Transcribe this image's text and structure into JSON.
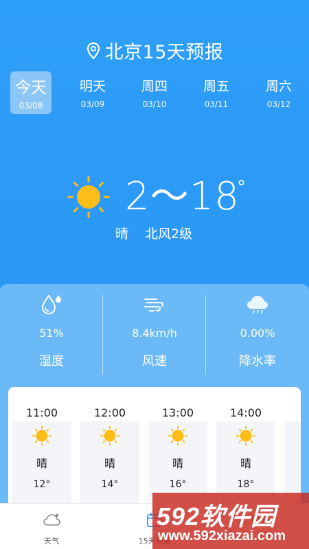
{
  "header": {
    "title": "北京15天预报",
    "location_icon": "location-pin-icon"
  },
  "days": [
    {
      "name": "今天",
      "date": "03/08",
      "active": true
    },
    {
      "name": "明天",
      "date": "03/09",
      "active": false
    },
    {
      "name": "周四",
      "date": "03/10",
      "active": false
    },
    {
      "name": "周五",
      "date": "03/11",
      "active": false
    },
    {
      "name": "周六",
      "date": "03/12",
      "active": false
    }
  ],
  "current": {
    "weather_icon": "sun-icon",
    "temp_range": "2～18",
    "degree_symbol": "°",
    "condition": "晴",
    "wind": "北风2级"
  },
  "stats": [
    {
      "icon": "humidity-icon",
      "value": "51%",
      "label": "湿度"
    },
    {
      "icon": "wind-speed-icon",
      "value": "8.4km/h",
      "label": "风速"
    },
    {
      "icon": "rain-cloud-icon",
      "value": "0.00%",
      "label": "降水率"
    }
  ],
  "hourly": [
    {
      "time": "11:00",
      "icon": "sun-icon",
      "condition": "晴",
      "temp": "12°"
    },
    {
      "time": "12:00",
      "icon": "sun-icon",
      "condition": "晴",
      "temp": "14°"
    },
    {
      "time": "13:00",
      "icon": "sun-icon",
      "condition": "晴",
      "temp": "16°"
    },
    {
      "time": "14:00",
      "icon": "sun-icon",
      "condition": "晴",
      "temp": "18°"
    }
  ],
  "tabs": [
    {
      "label": "天气",
      "icon": "cloud-icon"
    },
    {
      "label": "15天预报",
      "icon": "calendar-icon"
    },
    {
      "label": "",
      "icon": "settings-icon"
    }
  ],
  "watermark": {
    "line1": "592软件园",
    "line2": "www.592xiazai.com"
  },
  "colors": {
    "background": "#2d9bf7",
    "panel": "#6bbaf7",
    "active_day": "#8cc6f7",
    "sun": "#fdbd19"
  }
}
